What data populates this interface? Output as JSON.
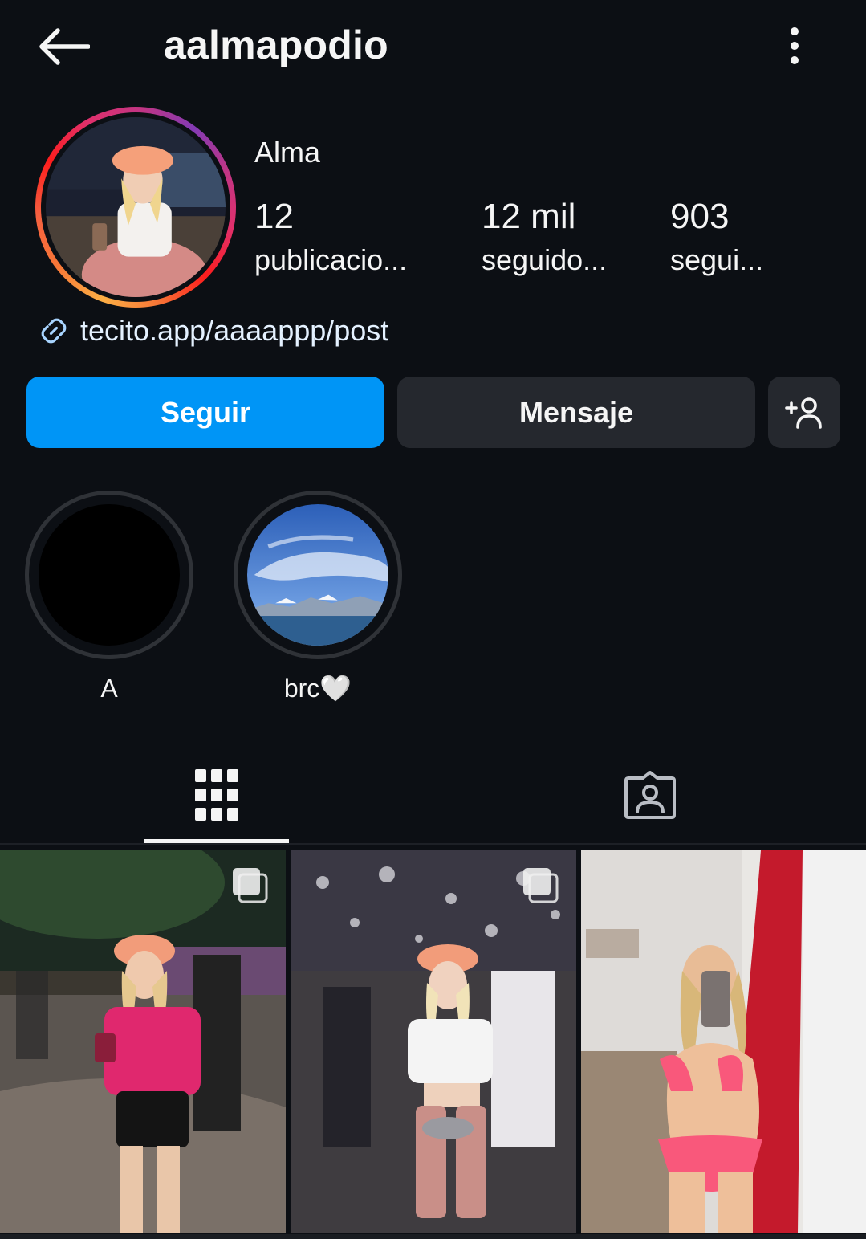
{
  "header": {
    "username": "aalmapodio",
    "back_icon": "arrow-left-icon",
    "more_icon": "more-vertical-icon"
  },
  "profile": {
    "display_name": "Alma",
    "stats": [
      {
        "value": "12",
        "label": "publicacio..."
      },
      {
        "value": "12 mil",
        "label": "seguido..."
      },
      {
        "value": "903",
        "label": "segui..."
      }
    ],
    "link": "tecito.app/aaaappp/post"
  },
  "actions": {
    "follow_label": "Seguir",
    "message_label": "Mensaje",
    "add_icon": "add-person-icon"
  },
  "highlights": [
    {
      "label": "A"
    },
    {
      "label": "brc🤍"
    }
  ],
  "tabs": [
    {
      "name": "grid",
      "icon": "grid-icon",
      "active": true
    },
    {
      "name": "tagged",
      "icon": "tagged-person-icon",
      "active": false
    }
  ],
  "posts": [
    {
      "multi": true
    },
    {
      "multi": true
    },
    {
      "multi": false
    }
  ],
  "colors": {
    "background": "#0c0f14",
    "follow_button": "#0095f6",
    "secondary_button": "#25282e"
  }
}
